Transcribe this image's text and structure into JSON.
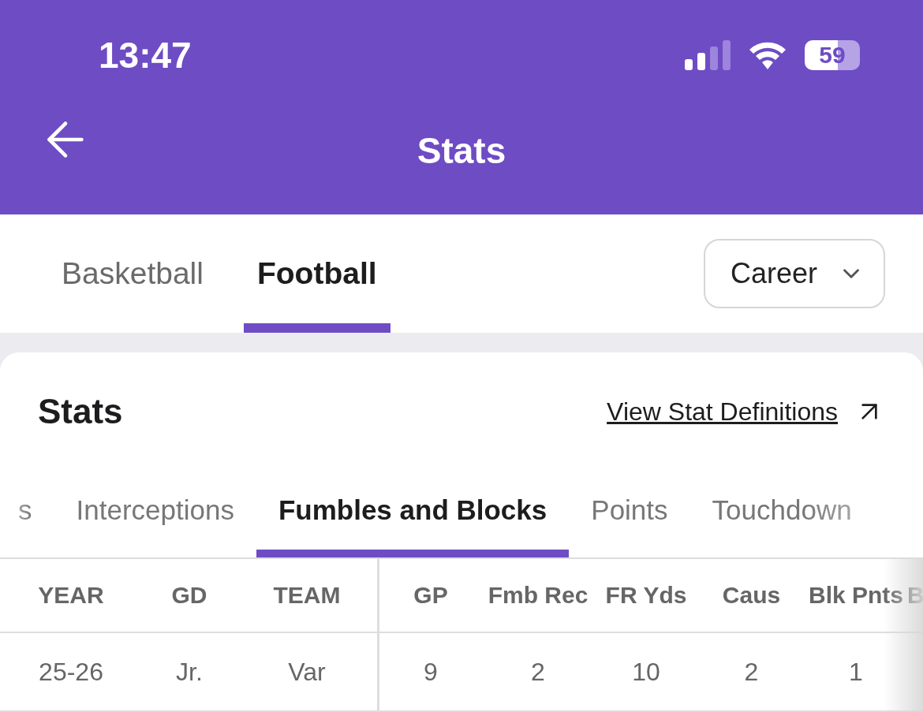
{
  "status_bar": {
    "time": "13:47",
    "battery": "59"
  },
  "header": {
    "title": "Stats"
  },
  "sport_tabs": [
    {
      "label": "Basketball",
      "selected": false
    },
    {
      "label": "Football",
      "selected": true
    }
  ],
  "period_select": {
    "value": "Career"
  },
  "card": {
    "title": "Stats",
    "link": "View Stat Definitions"
  },
  "category_tabs": [
    {
      "label": "s",
      "selected": false
    },
    {
      "label": "Interceptions",
      "selected": false
    },
    {
      "label": "Fumbles and Blocks",
      "selected": true
    },
    {
      "label": "Points",
      "selected": false
    },
    {
      "label": "Touchdown",
      "selected": false
    }
  ],
  "table": {
    "columns": [
      "YEAR",
      "GD",
      "TEAM",
      "GP",
      "Fmb Rec",
      "FR Yds",
      "Caus",
      "Blk Pnts",
      "B"
    ],
    "rows": [
      [
        "25-26",
        "Jr.",
        "Var",
        "9",
        "2",
        "10",
        "2",
        "1",
        ""
      ]
    ]
  }
}
